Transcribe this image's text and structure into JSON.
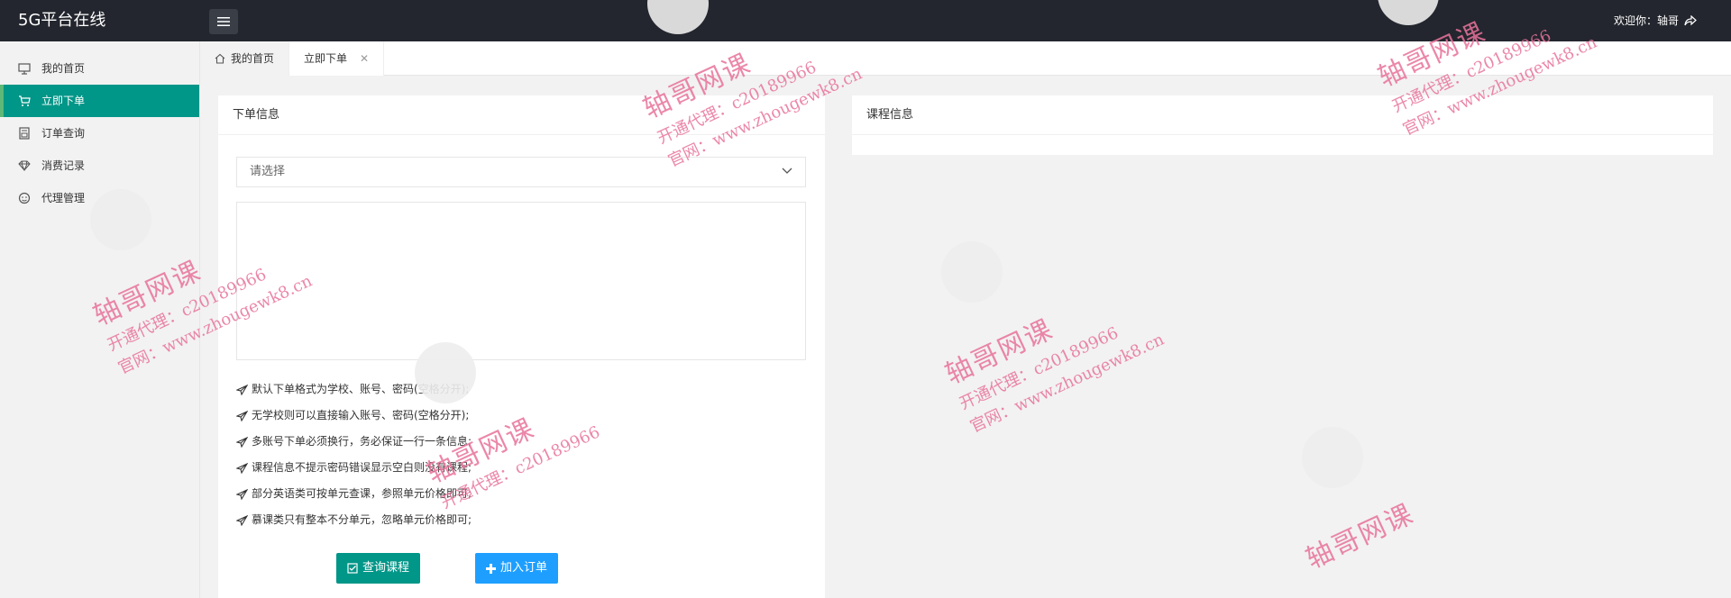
{
  "header": {
    "logo": "5G平台在线",
    "welcome": "欢迎你：轴哥"
  },
  "sidebar": {
    "items": [
      {
        "label": "我的首页",
        "icon": "monitor-icon"
      },
      {
        "label": "立即下单",
        "icon": "cart-icon",
        "active": true
      },
      {
        "label": "订单查询",
        "icon": "document-icon"
      },
      {
        "label": "消费记录",
        "icon": "diamond-icon"
      },
      {
        "label": "代理管理",
        "icon": "agent-icon"
      }
    ]
  },
  "tabs": [
    {
      "label": "我的首页",
      "icon": "home-icon"
    },
    {
      "label": "立即下单",
      "closable": true,
      "active": true
    }
  ],
  "order_card": {
    "title": "下单信息",
    "select_placeholder": "请选择",
    "textarea_value": "",
    "tips": [
      "默认下单格式为学校、账号、密码(空格分开);",
      "无学校则可以直接输入账号、密码(空格分开);",
      "多账号下单必须换行，务必保证一行一条信息;",
      "课程信息不提示密码错误显示空白则没有课程;",
      "部分英语类可按单元查课，参照单元价格即可;",
      "慕课类只有整本不分单元，忽略单元价格即可;"
    ],
    "query_button": "查询课程",
    "add_button": "加入订单"
  },
  "course_card": {
    "title": "课程信息"
  },
  "watermark": {
    "brand": "轴哥网课",
    "agent": "开通代理：c20189966",
    "site": "官网：www.zhougewk8.cn"
  },
  "colors": {
    "header_bg": "#23262e",
    "active": "#009688",
    "primary_blue": "#1e9fff",
    "watermark": "#e8739b"
  }
}
